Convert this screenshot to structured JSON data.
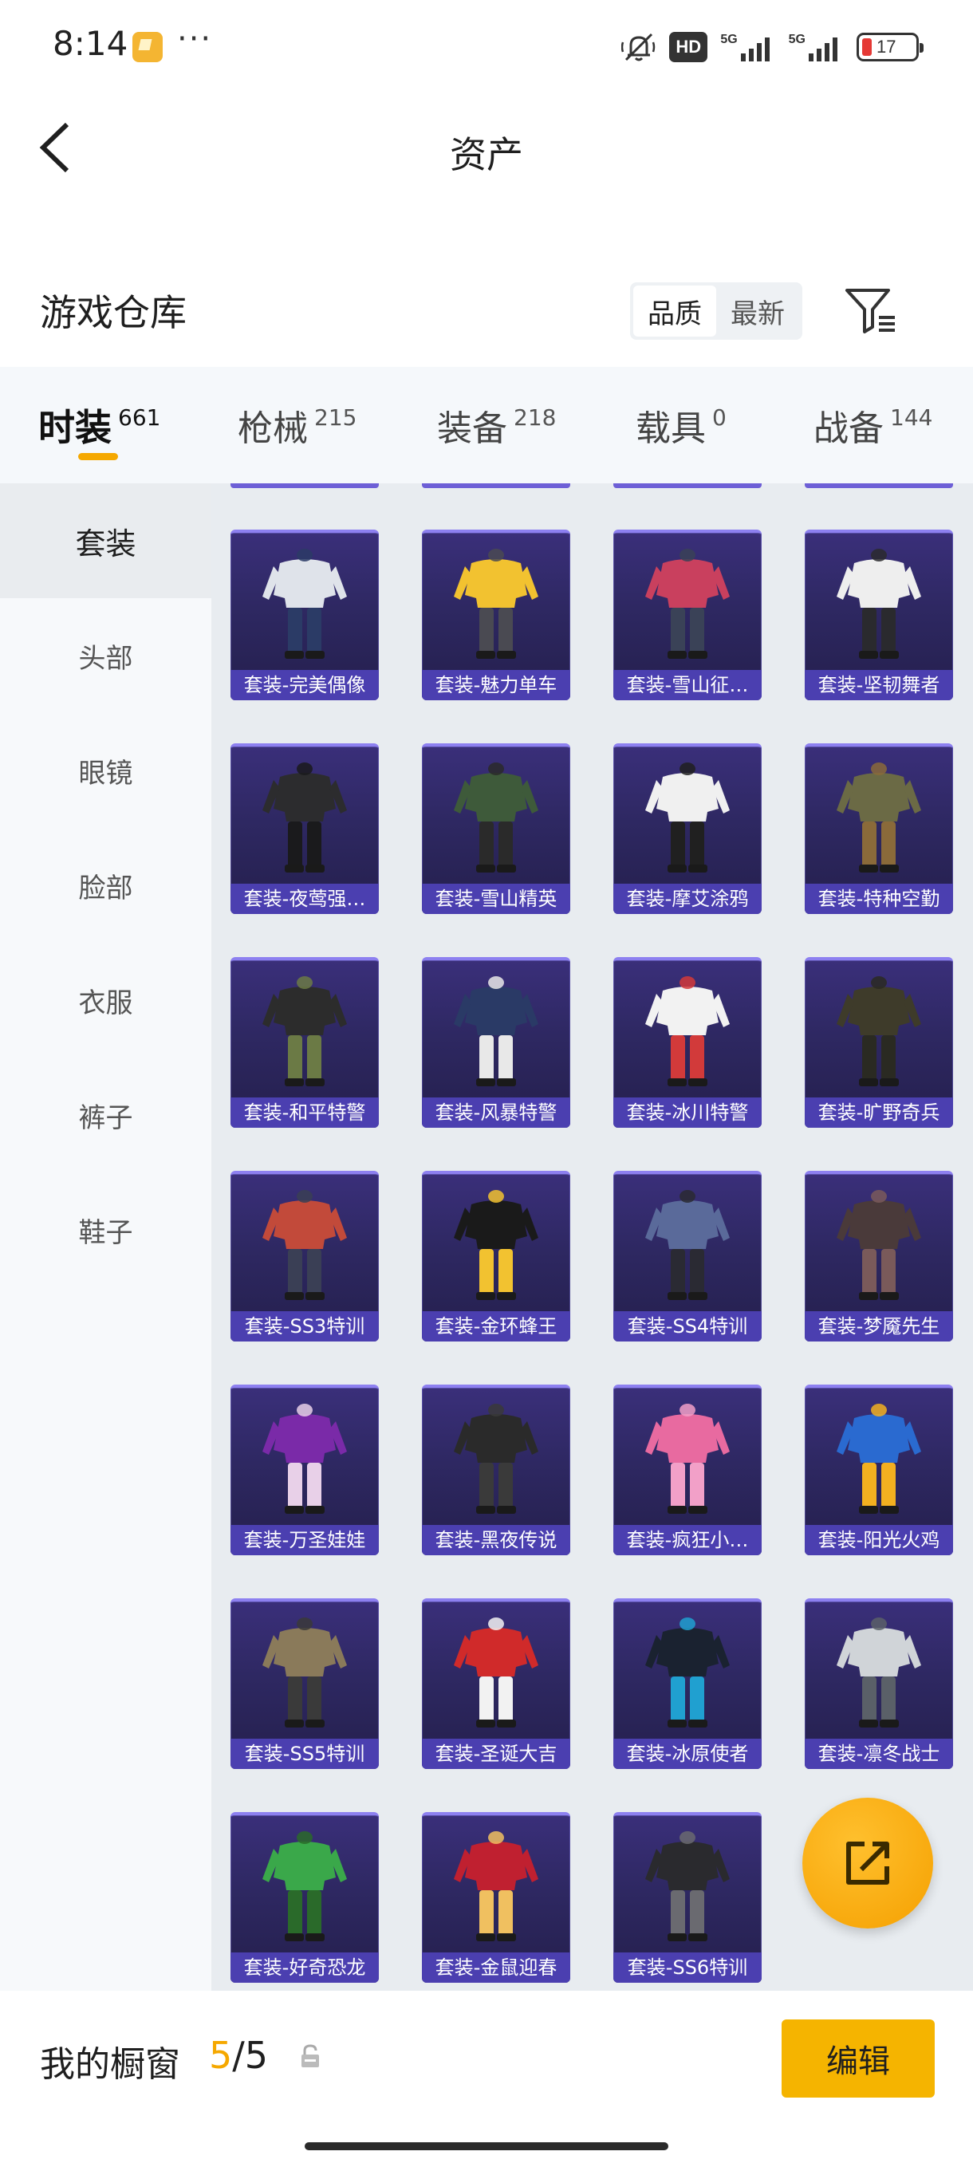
{
  "status_bar": {
    "time": "8:14",
    "dots": "···",
    "hd_label": "HD",
    "network_1": "5G",
    "network_2": "5G",
    "battery": "17",
    "battery_color": "#e53935"
  },
  "header": {
    "title": "资产",
    "back_icon": "chevron-left-icon"
  },
  "warehouse": {
    "title": "游戏仓库",
    "sort_options": [
      "品质",
      "最新"
    ],
    "active_sort": "品质",
    "filter_icon": "filter-icon"
  },
  "tabs": [
    {
      "label": "时装",
      "count": "661",
      "active": true
    },
    {
      "label": "枪械",
      "count": "215",
      "active": false
    },
    {
      "label": "装备",
      "count": "218",
      "active": false
    },
    {
      "label": "载具",
      "count": "0",
      "active": false
    },
    {
      "label": "战备",
      "count": "144",
      "active": false
    }
  ],
  "sidebar": {
    "items": [
      {
        "label": "套装",
        "active": true
      },
      {
        "label": "头部",
        "active": false
      },
      {
        "label": "眼镜",
        "active": false
      },
      {
        "label": "脸部",
        "active": false
      },
      {
        "label": "衣服",
        "active": false
      },
      {
        "label": "裤子",
        "active": false
      },
      {
        "label": "鞋子",
        "active": false
      }
    ]
  },
  "items": [
    {
      "label": "套装-完美偶像",
      "palette": [
        "#dfe3ea",
        "#2b3b66"
      ]
    },
    {
      "label": "套装-魅力单车",
      "palette": [
        "#f2c230",
        "#4a4a52"
      ]
    },
    {
      "label": "套装-雪山征…",
      "palette": [
        "#c9405e",
        "#3a4257"
      ]
    },
    {
      "label": "套装-坚韧舞者",
      "palette": [
        "#eeeeee",
        "#2a2a2e"
      ]
    },
    {
      "label": "套装-夜莺强…",
      "palette": [
        "#2c2c2e",
        "#1a1a1c"
      ]
    },
    {
      "label": "套装-雪山精英",
      "palette": [
        "#3e5a3a",
        "#2a2a2a"
      ]
    },
    {
      "label": "套装-摩艾涂鸦",
      "palette": [
        "#f0f0f0",
        "#202020"
      ]
    },
    {
      "label": "套装-特种空勤",
      "palette": [
        "#6b6a45",
        "#8a6a3a"
      ]
    },
    {
      "label": "套装-和平特警",
      "palette": [
        "#2c2c2c",
        "#6b7a45"
      ]
    },
    {
      "label": "套装-风暴特警",
      "palette": [
        "#2a3a66",
        "#e8e8e8"
      ]
    },
    {
      "label": "套装-冰川特警",
      "palette": [
        "#f2f2f2",
        "#d23a3a"
      ]
    },
    {
      "label": "套装-旷野奇兵",
      "palette": [
        "#3e3b2a",
        "#2a2a22"
      ]
    },
    {
      "label": "套装-SS3特训",
      "palette": [
        "#c24a3a",
        "#3a3f55"
      ]
    },
    {
      "label": "套装-金环蜂王",
      "palette": [
        "#1a1a1a",
        "#f2c230"
      ]
    },
    {
      "label": "套装-SS4特训",
      "palette": [
        "#5a6a9a",
        "#2a2a33"
      ]
    },
    {
      "label": "套装-梦魇先生",
      "palette": [
        "#4a3a3a",
        "#7a5a5a"
      ]
    },
    {
      "label": "套装-万圣娃娃",
      "palette": [
        "#7a2aa8",
        "#e8d0e8"
      ]
    },
    {
      "label": "套装-黑夜传说",
      "palette": [
        "#2a2a2a",
        "#3a3a3a"
      ]
    },
    {
      "label": "套装-疯狂小…",
      "palette": [
        "#e86aa0",
        "#f2a0c8"
      ]
    },
    {
      "label": "套装-阳光火鸡",
      "palette": [
        "#2a6ad0",
        "#f2b020"
      ]
    },
    {
      "label": "套装-SS5特训",
      "palette": [
        "#8a7a5a",
        "#3a3a3a"
      ]
    },
    {
      "label": "套装-圣诞大吉",
      "palette": [
        "#d02a2a",
        "#f2f2f2"
      ]
    },
    {
      "label": "套装-冰原使者",
      "palette": [
        "#1a2230",
        "#20a0d0"
      ]
    },
    {
      "label": "套装-凛冬战士",
      "palette": [
        "#d0d4d8",
        "#5a6068"
      ]
    },
    {
      "label": "套装-好奇恐龙",
      "palette": [
        "#3aa84a",
        "#2a6a2a"
      ]
    },
    {
      "label": "套装-金鼠迎春",
      "palette": [
        "#c02030",
        "#f0c060"
      ]
    },
    {
      "label": "套装-SS6特训",
      "palette": [
        "#2a2a2e",
        "#6a6a70"
      ]
    }
  ],
  "fab": {
    "icon": "share-external-icon"
  },
  "bottom": {
    "showcase_label": "我的橱窗",
    "showcase_current": "5",
    "showcase_sep": "/",
    "showcase_total": "5",
    "lock_icon": "lock-icon",
    "edit_label": "编辑"
  },
  "accent_color": "#f5a800"
}
